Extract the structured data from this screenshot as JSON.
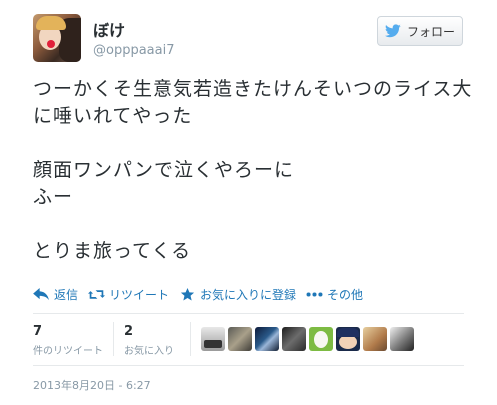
{
  "user": {
    "name": "ぼけ",
    "handle": "@opppaaai7"
  },
  "follow": {
    "label": "フォロー"
  },
  "tweet": {
    "text": "つーかくそ生意気若造きたけんそいつのライス大に唾いれてやった\n\n顔面ワンパンで泣くやろーに\nふー\n\nとりま旅ってくる"
  },
  "actions": {
    "reply": "返信",
    "retweet": "リツイート",
    "favorite": "お気に入りに登録",
    "more": "その他"
  },
  "stats": {
    "retweets_count": "7",
    "retweets_label": "件のリツイート",
    "favorites_count": "2",
    "favorites_label": "お気に入り"
  },
  "timestamp": "2013年8月20日 - 6:27",
  "colors": {
    "link": "#1f77b7",
    "twitter_blue": "#55acee",
    "muted": "#8899a6"
  }
}
